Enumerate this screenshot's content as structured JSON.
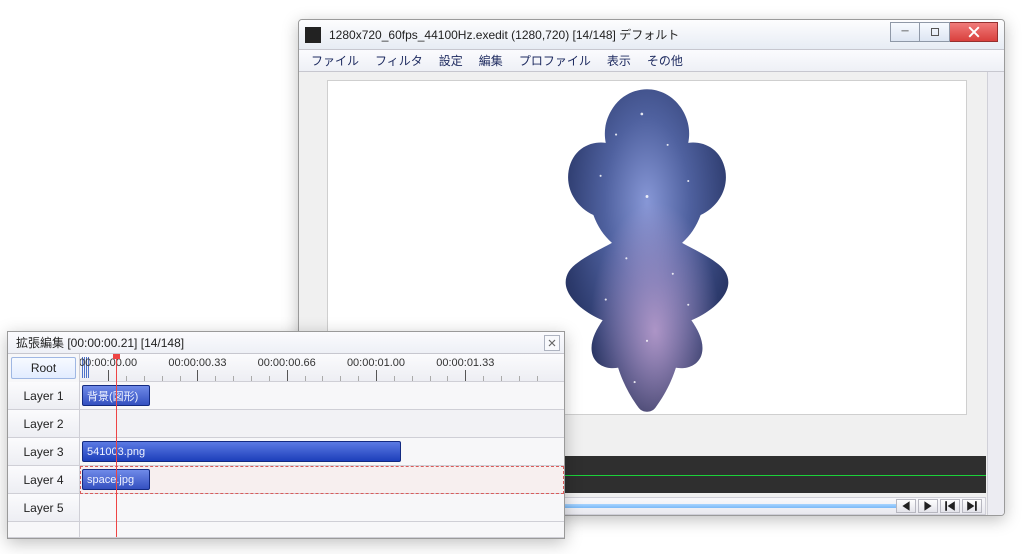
{
  "main": {
    "title": "1280x720_60fps_44100Hz.exedit (1280,720) [14/148] デフォルト",
    "menu": [
      "ファイル",
      "フィルタ",
      "設定",
      "編集",
      "プロファイル",
      "表示",
      "その他"
    ]
  },
  "transport": {
    "prev_frame": "prev-frame",
    "play": "play",
    "to_start": "to-start",
    "to_end": "to-end"
  },
  "timeline": {
    "title": "拡張編集 [00:00:00.21] [14/148]",
    "root_label": "Root",
    "ruler": [
      "00:00:00.00",
      "00:00:00.33",
      "00:00:00.66",
      "00:00:01.00",
      "00:00:01.33"
    ],
    "layers": [
      {
        "label": "Layer 1",
        "clip": {
          "name": "背景(図形)",
          "start": 0,
          "width": 14,
          "short": true
        }
      },
      {
        "label": "Layer 2",
        "clip": null
      },
      {
        "label": "Layer 3",
        "clip": {
          "name": "541003.png",
          "start": 0,
          "width": 66,
          "short": false
        }
      },
      {
        "label": "Layer 4",
        "clip": {
          "name": "space.jpg",
          "start": 0,
          "width": 14,
          "short": true
        },
        "selected": true
      },
      {
        "label": "Layer 5",
        "clip": null
      }
    ],
    "playhead_percent": 5
  }
}
